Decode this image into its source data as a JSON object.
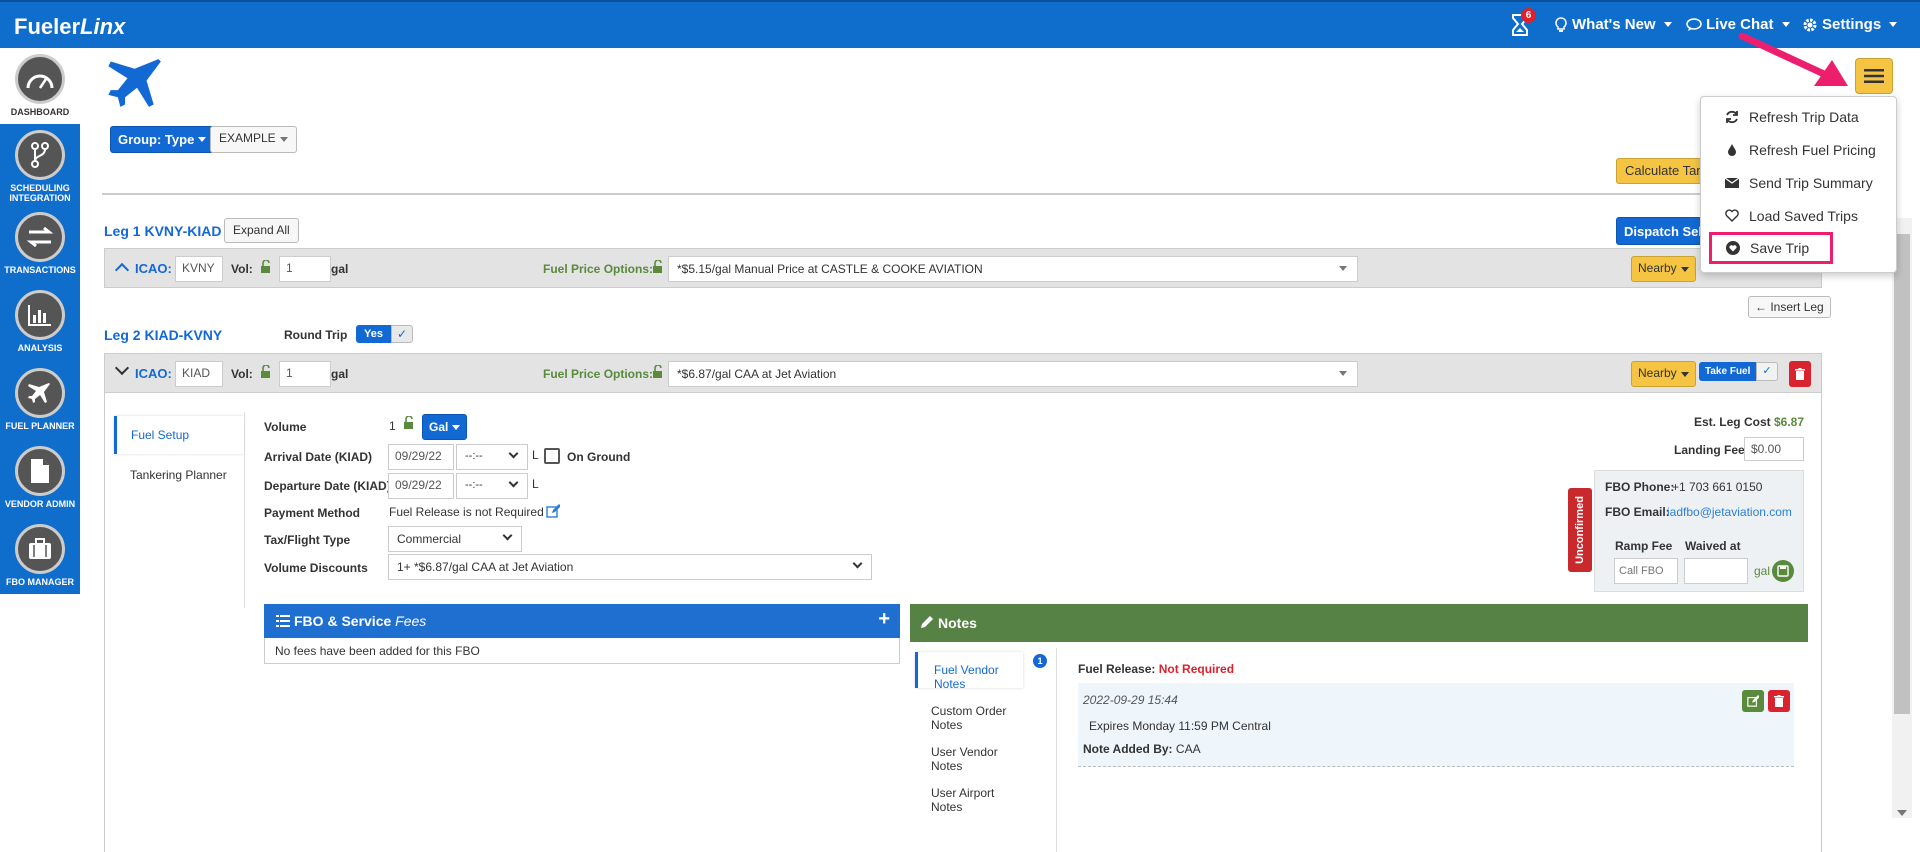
{
  "app": {
    "brand_main": "Fueler",
    "brand_italic": "Linx"
  },
  "topnav": {
    "badge_count": "6",
    "whats_new": "What's New",
    "live_chat": "Live Chat",
    "settings": "Settings"
  },
  "sidebar": {
    "items": [
      {
        "label": "DASHBOARD"
      },
      {
        "label": "SCHEDULING INTEGRATION"
      },
      {
        "label": "TRANSACTIONS"
      },
      {
        "label": "ANALYSIS"
      },
      {
        "label": "FUEL PLANNER"
      },
      {
        "label": "VENDOR ADMIN"
      },
      {
        "label": "FBO MANAGER"
      }
    ]
  },
  "toolbar": {
    "group_type": "Group: Type",
    "example": "EXAMPLE",
    "calculate": "Calculate Tan",
    "dispatch": "Dispatch Sele"
  },
  "menu": {
    "refresh_trip": "Refresh Trip Data",
    "refresh_fuel": "Refresh Fuel Pricing",
    "send_summary": "Send Trip Summary",
    "load_saved": "Load Saved Trips",
    "save_trip": "Save Trip"
  },
  "leg1": {
    "title": "Leg 1 KVNY-KIAD",
    "expand_all": "Expand All",
    "icao_label": "ICAO:",
    "icao_value": "KVNY",
    "vol_label": "Vol:",
    "vol_value": "1",
    "gal": "gal",
    "fuel_options_label": "Fuel Price Options:",
    "fuel_option": "*$5.15/gal Manual Price at CASTLE & COOKE AVIATION",
    "nearby": "Nearby"
  },
  "insert_leg": "Insert Leg",
  "leg2": {
    "title": "Leg 2 KIAD-KVNY",
    "round_trip_label": "Round Trip",
    "round_trip_yes": "Yes",
    "icao_label": "ICAO:",
    "icao_value": "KIAD",
    "vol_label": "Vol:",
    "vol_value": "1",
    "gal": "gal",
    "fuel_options_label": "Fuel Price Options:",
    "fuel_option": "*$6.87/gal CAA at Jet Aviation",
    "nearby": "Nearby",
    "take_fuel": "Take Fuel"
  },
  "tabs": {
    "fuel_setup": "Fuel Setup",
    "tankering": "Tankering Planner"
  },
  "form": {
    "volume_label": "Volume",
    "volume_value": "1",
    "gal_btn": "Gal",
    "arrival_label": "Arrival Date (KIAD)",
    "arrival_date": "09/29/22",
    "arrival_time": "--:--",
    "l1": "L",
    "on_ground": "On Ground",
    "departure_label": "Departure Date (KIAD)",
    "departure_date": "09/29/22",
    "departure_time": "--:--",
    "l2": "L",
    "payment_label": "Payment Method",
    "payment_value": "Fuel Release is not Required",
    "tax_label": "Tax/Flight Type",
    "tax_value": "Commercial",
    "discounts_label": "Volume Discounts",
    "discounts_value": "1+ *$6.87/gal CAA at Jet Aviation"
  },
  "right": {
    "est_leg_label": "Est. Leg Cost",
    "est_leg_value": "$6.87",
    "landing_fee_label": "Landing Fee",
    "landing_fee_value": "$0.00",
    "unconfirmed": "Unconfirmed",
    "fbo_phone_label": "FBO Phone:",
    "fbo_phone": "+1 703 661 0150",
    "fbo_email_label": "FBO Email:",
    "fbo_email": "iadfbo@jetaviation.com",
    "ramp_fee_label": "Ramp Fee",
    "waived_label": "Waived at",
    "ramp_fee_placeholder": "Call FBO",
    "gal": "gal"
  },
  "fees": {
    "title_bold": "FBO & Service",
    "title_italic": "Fees",
    "empty": "No fees have been added for this FBO"
  },
  "notes": {
    "title": "Notes",
    "tabs": [
      "Fuel Vendor Notes",
      "Custom Order Notes",
      "User Vendor Notes",
      "User Airport Notes"
    ],
    "tab_badge": "1",
    "fuel_release_label": "Fuel Release:",
    "fuel_release_value": "Not Required",
    "note_date": "2022-09-29 15:44",
    "note_text": "Expires Monday 11:59 PM Central",
    "added_by_label": "Note Added By:",
    "added_by": "CAA"
  },
  "colors": {
    "brand_blue": "#0f6dcc",
    "green": "#568246",
    "red": "#d9232e",
    "yellow": "#f5c443",
    "pink": "#ee1e6e"
  }
}
